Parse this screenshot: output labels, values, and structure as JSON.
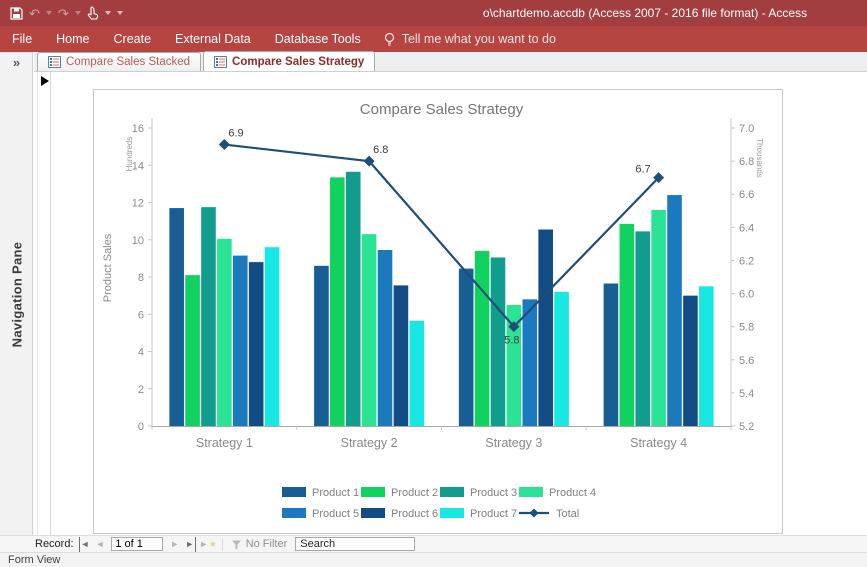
{
  "window": {
    "title": "o\\chartdemo.accdb (Access 2007 - 2016 file format)  -  Access"
  },
  "quick_access": {
    "undo_glyph": "↶",
    "redo_glyph": "↷"
  },
  "ribbon": {
    "tabs": [
      {
        "label": "File"
      },
      {
        "label": "Home"
      },
      {
        "label": "Create"
      },
      {
        "label": "External Data"
      },
      {
        "label": "Database Tools"
      }
    ],
    "tell_me": "Tell me what you want to do"
  },
  "doc_tabs": [
    {
      "label": "Compare Sales Stacked",
      "active": false
    },
    {
      "label": "Compare Sales Strategy",
      "active": true
    }
  ],
  "nav_pane": {
    "collapse_glyph": "»",
    "label": "Navigation Pane"
  },
  "record_bar": {
    "label": "Record:",
    "first_glyph": "◄",
    "prev_glyph": "◄",
    "position": "1 of 1",
    "next_glyph": "►",
    "last_glyph": "►",
    "new_glyph": "►",
    "new_star": "∗",
    "filter_label": "No Filter",
    "search_placeholder": "Search"
  },
  "status_bar": {
    "text": "Form View"
  },
  "chart_data": {
    "type": "bar+line",
    "title": "Compare Sales Strategy",
    "categories": [
      "Strategy 1",
      "Strategy 2",
      "Strategy 3",
      "Strategy 4"
    ],
    "bar_series": [
      {
        "name": "Product 1",
        "color": "#175E94",
        "values": [
          11.7,
          8.6,
          8.45,
          7.65
        ]
      },
      {
        "name": "Product 2",
        "color": "#10D25F",
        "values": [
          8.1,
          13.35,
          9.4,
          10.85
        ]
      },
      {
        "name": "Product 3",
        "color": "#119C8D",
        "values": [
          11.75,
          13.65,
          9.05,
          10.45
        ]
      },
      {
        "name": "Product 4",
        "color": "#2BE394",
        "values": [
          10.05,
          10.3,
          6.5,
          11.6
        ]
      },
      {
        "name": "Product 5",
        "color": "#1B79BE",
        "values": [
          9.15,
          9.45,
          6.8,
          12.4
        ]
      },
      {
        "name": "Product 6",
        "color": "#134C84",
        "values": [
          8.8,
          7.55,
          10.55,
          7.0
        ]
      },
      {
        "name": "Product 7",
        "color": "#18E8E4",
        "values": [
          9.6,
          5.65,
          7.2,
          7.5
        ]
      }
    ],
    "line_series": {
      "name": "Total",
      "color": "#1F4E79",
      "values": [
        6.9,
        6.8,
        5.8,
        6.7
      ],
      "labels": [
        "6.9",
        "6.8",
        "5.8",
        "6.7"
      ],
      "label_positions": [
        "above-right",
        "above-right",
        "below",
        "above-left"
      ]
    },
    "left_axis": {
      "title": "Product Sales",
      "units": "Hundreds",
      "min": 0,
      "max": 16,
      "step": 2
    },
    "right_axis": {
      "units": "Thousands",
      "min": 5.2,
      "max": 7.0,
      "step": 0.2
    },
    "legend_position": "bottom",
    "grid": false
  }
}
